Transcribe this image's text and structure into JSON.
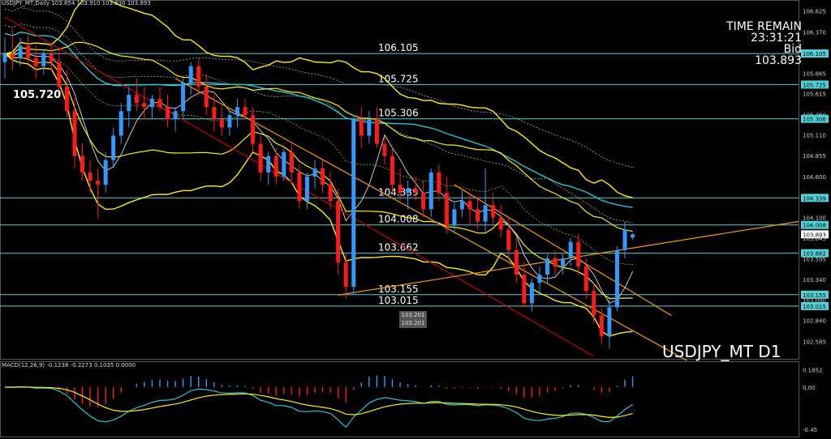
{
  "window": {
    "header": "USDJPY_MT,Daily  103.854 103.910 103.830 103.893",
    "macd_header": "MACD(12,26,9) -0.1238 -0.2273 0.1035 0.0000",
    "symbol": "USDJPY_MT D1",
    "big_price": "105.720",
    "tooltip_top": "103.201",
    "tooltip_bottom": "103.201"
  },
  "info_panel": {
    "line1": "TIME REMAIN",
    "line2": "23:31:21",
    "line3": "Bid",
    "line4": "103.893"
  },
  "colors": {
    "bull": "#3399ff",
    "bear": "#ff1a1a",
    "bollinger": "#ffee00",
    "ma_cyan": "#22c8d8",
    "trend_red": "#cc0000",
    "trend_orange": "#ff9900",
    "level_line": "#4fd3d9"
  },
  "chart_data": {
    "type": "candlestick",
    "y_axis": {
      "min": 102.4,
      "max": 106.72,
      "tick_labels": [
        "106.625",
        "106.370",
        "106.105",
        "105.865",
        "105.725",
        "105.615",
        "105.360",
        "105.306",
        "105.110",
        "104.855",
        "104.600",
        "104.339",
        "104.100",
        "104.008",
        "103.893",
        "103.845",
        "103.662",
        "103.595",
        "103.340",
        "103.155",
        "103.090",
        "103.015",
        "102.840",
        "102.585"
      ]
    },
    "levels": [
      {
        "label": "106.105",
        "value": 106.105
      },
      {
        "label": "105.725",
        "value": 105.725
      },
      {
        "label": "105.306",
        "value": 105.306
      },
      {
        "label": "104.339",
        "value": 104.339
      },
      {
        "label": "104.008",
        "value": 104.008
      },
      {
        "label": "103.662",
        "value": 103.662
      },
      {
        "label": "103.155",
        "value": 103.155
      },
      {
        "label": "103.015",
        "value": 103.015
      }
    ],
    "candles": [
      {
        "o": 106.0,
        "h": 106.3,
        "l": 105.8,
        "c": 106.1
      },
      {
        "o": 106.1,
        "h": 106.4,
        "l": 105.9,
        "c": 106.05
      },
      {
        "o": 106.05,
        "h": 106.3,
        "l": 105.95,
        "c": 106.2
      },
      {
        "o": 106.2,
        "h": 106.35,
        "l": 105.95,
        "c": 106.05
      },
      {
        "o": 106.05,
        "h": 106.2,
        "l": 105.8,
        "c": 105.95
      },
      {
        "o": 105.95,
        "h": 106.15,
        "l": 105.85,
        "c": 106.1
      },
      {
        "o": 106.1,
        "h": 106.2,
        "l": 105.9,
        "c": 106.0
      },
      {
        "o": 106.0,
        "h": 106.15,
        "l": 105.6,
        "c": 105.7
      },
      {
        "o": 105.7,
        "h": 105.9,
        "l": 105.3,
        "c": 105.4
      },
      {
        "o": 105.4,
        "h": 105.55,
        "l": 104.7,
        "c": 104.85
      },
      {
        "o": 104.85,
        "h": 105.0,
        "l": 104.55,
        "c": 104.65
      },
      {
        "o": 104.65,
        "h": 104.8,
        "l": 104.4,
        "c": 104.55
      },
      {
        "o": 104.55,
        "h": 104.7,
        "l": 104.1,
        "c": 104.5
      },
      {
        "o": 104.5,
        "h": 104.9,
        "l": 104.4,
        "c": 104.8
      },
      {
        "o": 104.8,
        "h": 105.2,
        "l": 104.7,
        "c": 105.1
      },
      {
        "o": 105.1,
        "h": 105.5,
        "l": 105.0,
        "c": 105.4
      },
      {
        "o": 105.4,
        "h": 105.7,
        "l": 105.2,
        "c": 105.6
      },
      {
        "o": 105.6,
        "h": 105.8,
        "l": 105.4,
        "c": 105.5
      },
      {
        "o": 105.5,
        "h": 105.7,
        "l": 105.3,
        "c": 105.45
      },
      {
        "o": 105.45,
        "h": 105.6,
        "l": 105.3,
        "c": 105.55
      },
      {
        "o": 105.55,
        "h": 105.7,
        "l": 105.4,
        "c": 105.45
      },
      {
        "o": 105.45,
        "h": 105.6,
        "l": 105.2,
        "c": 105.3
      },
      {
        "o": 105.3,
        "h": 105.45,
        "l": 105.15,
        "c": 105.4
      },
      {
        "o": 105.4,
        "h": 105.8,
        "l": 105.3,
        "c": 105.75
      },
      {
        "o": 105.75,
        "h": 106.0,
        "l": 105.6,
        "c": 105.95
      },
      {
        "o": 105.95,
        "h": 106.05,
        "l": 105.6,
        "c": 105.7
      },
      {
        "o": 105.7,
        "h": 105.85,
        "l": 105.35,
        "c": 105.45
      },
      {
        "o": 105.45,
        "h": 105.6,
        "l": 105.15,
        "c": 105.3
      },
      {
        "o": 105.3,
        "h": 105.45,
        "l": 105.1,
        "c": 105.2
      },
      {
        "o": 105.2,
        "h": 105.4,
        "l": 105.1,
        "c": 105.35
      },
      {
        "o": 105.35,
        "h": 105.55,
        "l": 105.2,
        "c": 105.45
      },
      {
        "o": 105.45,
        "h": 105.55,
        "l": 105.3,
        "c": 105.35
      },
      {
        "o": 105.35,
        "h": 105.45,
        "l": 104.9,
        "c": 105.0
      },
      {
        "o": 105.0,
        "h": 105.1,
        "l": 104.55,
        "c": 104.65
      },
      {
        "o": 104.65,
        "h": 104.9,
        "l": 104.5,
        "c": 104.85
      },
      {
        "o": 104.85,
        "h": 104.95,
        "l": 104.5,
        "c": 104.6
      },
      {
        "o": 104.6,
        "h": 104.95,
        "l": 104.55,
        "c": 104.9
      },
      {
        "o": 104.9,
        "h": 105.0,
        "l": 104.55,
        "c": 104.65
      },
      {
        "o": 104.65,
        "h": 104.75,
        "l": 104.2,
        "c": 104.3
      },
      {
        "o": 104.3,
        "h": 104.65,
        "l": 104.2,
        "c": 104.6
      },
      {
        "o": 104.6,
        "h": 104.8,
        "l": 104.45,
        "c": 104.7
      },
      {
        "o": 104.7,
        "h": 104.8,
        "l": 104.4,
        "c": 104.5
      },
      {
        "o": 104.5,
        "h": 104.65,
        "l": 104.2,
        "c": 104.3
      },
      {
        "o": 104.3,
        "h": 104.45,
        "l": 103.4,
        "c": 103.55
      },
      {
        "o": 103.55,
        "h": 103.65,
        "l": 103.1,
        "c": 103.25
      },
      {
        "o": 103.25,
        "h": 105.35,
        "l": 103.15,
        "c": 105.3
      },
      {
        "o": 105.3,
        "h": 105.45,
        "l": 104.95,
        "c": 105.1
      },
      {
        "o": 105.1,
        "h": 105.4,
        "l": 105.0,
        "c": 105.3
      },
      {
        "o": 105.3,
        "h": 105.45,
        "l": 104.95,
        "c": 105.0
      },
      {
        "o": 105.0,
        "h": 105.1,
        "l": 104.75,
        "c": 104.85
      },
      {
        "o": 104.85,
        "h": 104.95,
        "l": 104.4,
        "c": 104.5
      },
      {
        "o": 104.5,
        "h": 104.7,
        "l": 104.3,
        "c": 104.4
      },
      {
        "o": 104.4,
        "h": 104.55,
        "l": 104.2,
        "c": 104.45
      },
      {
        "o": 104.45,
        "h": 104.6,
        "l": 104.3,
        "c": 104.4
      },
      {
        "o": 104.4,
        "h": 104.55,
        "l": 104.1,
        "c": 104.2
      },
      {
        "o": 104.2,
        "h": 104.7,
        "l": 104.1,
        "c": 104.65
      },
      {
        "o": 104.65,
        "h": 104.75,
        "l": 104.3,
        "c": 104.4
      },
      {
        "o": 104.4,
        "h": 104.6,
        "l": 103.9,
        "c": 104.0
      },
      {
        "o": 104.0,
        "h": 104.3,
        "l": 103.9,
        "c": 104.2
      },
      {
        "o": 104.2,
        "h": 104.45,
        "l": 104.1,
        "c": 104.3
      },
      {
        "o": 104.3,
        "h": 104.4,
        "l": 104.0,
        "c": 104.2
      },
      {
        "o": 104.2,
        "h": 104.35,
        "l": 103.95,
        "c": 104.05
      },
      {
        "o": 104.05,
        "h": 104.7,
        "l": 103.9,
        "c": 104.25
      },
      {
        "o": 104.25,
        "h": 104.4,
        "l": 104.0,
        "c": 104.1
      },
      {
        "o": 104.1,
        "h": 104.25,
        "l": 103.85,
        "c": 103.95
      },
      {
        "o": 103.95,
        "h": 104.1,
        "l": 103.6,
        "c": 103.7
      },
      {
        "o": 103.7,
        "h": 103.85,
        "l": 103.3,
        "c": 103.4
      },
      {
        "o": 103.4,
        "h": 103.55,
        "l": 103.0,
        "c": 103.05
      },
      {
        "o": 103.05,
        "h": 103.35,
        "l": 102.95,
        "c": 103.3
      },
      {
        "o": 103.3,
        "h": 103.5,
        "l": 103.15,
        "c": 103.4
      },
      {
        "o": 103.4,
        "h": 103.65,
        "l": 103.3,
        "c": 103.6
      },
      {
        "o": 103.6,
        "h": 103.7,
        "l": 103.4,
        "c": 103.5
      },
      {
        "o": 103.5,
        "h": 103.65,
        "l": 103.4,
        "c": 103.6
      },
      {
        "o": 103.6,
        "h": 103.85,
        "l": 103.5,
        "c": 103.8
      },
      {
        "o": 103.8,
        "h": 103.9,
        "l": 103.4,
        "c": 103.5
      },
      {
        "o": 103.5,
        "h": 103.6,
        "l": 103.1,
        "c": 103.2
      },
      {
        "o": 103.2,
        "h": 103.3,
        "l": 102.8,
        "c": 102.9
      },
      {
        "o": 102.9,
        "h": 103.0,
        "l": 102.55,
        "c": 102.65
      },
      {
        "o": 102.65,
        "h": 103.1,
        "l": 102.5,
        "c": 103.0
      },
      {
        "o": 103.0,
        "h": 103.75,
        "l": 102.95,
        "c": 103.7
      },
      {
        "o": 103.7,
        "h": 104.05,
        "l": 103.6,
        "c": 103.95
      },
      {
        "o": 103.854,
        "h": 103.91,
        "l": 103.83,
        "c": 103.893
      }
    ],
    "macd_axis": {
      "tick_labels": [
        "0.1852",
        "0.00",
        "-0.45"
      ],
      "min": -0.5,
      "max": 0.24
    },
    "macd_histogram_note": "MACD(12,26,9)"
  }
}
